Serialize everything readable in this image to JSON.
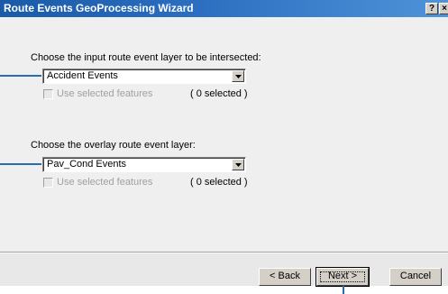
{
  "window": {
    "title": "Route Events GeoProcessing Wizard",
    "help_label": "?",
    "close_label": "×"
  },
  "input_section": {
    "prompt": "Choose the input route event layer to be intersected:",
    "selected_layer": "Accident Events",
    "use_selected_label": "Use selected features",
    "selected_count": "( 0 selected )"
  },
  "overlay_section": {
    "prompt": "Choose the overlay route event layer:",
    "selected_layer": "Pav_Cond Events",
    "use_selected_label": "Use selected features",
    "selected_count": "( 0 selected )"
  },
  "buttons": {
    "back": "< Back",
    "next": "Next >",
    "cancel": "Cancel"
  },
  "colors": {
    "title_bar": "#2c6fc0",
    "callout_line": "#2b6cb0"
  }
}
